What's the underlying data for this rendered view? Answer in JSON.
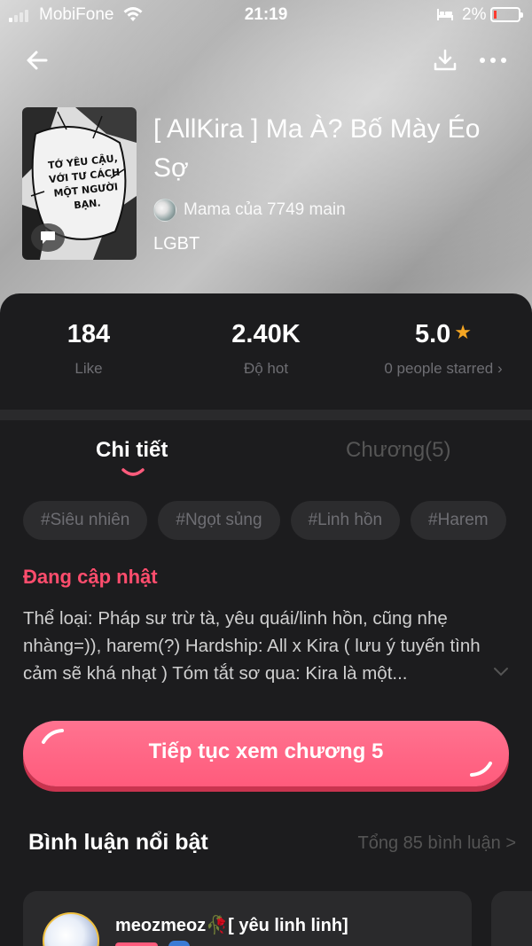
{
  "status_bar": {
    "carrier": "MobiFone",
    "time": "21:19",
    "battery": "2%"
  },
  "book": {
    "title": "[ AllKira ] Ma À? Bố Mày Éo Sợ",
    "author": "Mama của 7749 main",
    "genre": "LGBT",
    "cover_text": "TỚ YÊU CẬU, VỚI TƯ CÁCH MỘT NGƯỜI BẠN."
  },
  "stats": [
    {
      "value": "184",
      "label": "Like"
    },
    {
      "value": "2.40K",
      "label": "Độ hot"
    },
    {
      "value": "5.0",
      "label": "0 people starred ›"
    }
  ],
  "tabs": {
    "details": "Chi tiết",
    "chapters": "Chương(5)"
  },
  "tags": [
    "#Siêu nhiên",
    "#Ngọt sủng",
    "#Linh hồn",
    "#Harem"
  ],
  "status_label": "Đang cập nhật",
  "description": "Thể loại: Pháp sư trừ tà, yêu quái/linh hồn, cũng nhẹ nhàng=)), harem(?)  Hardship: All x Kira ( lưu ý tuyến tình cảm sẽ khá nhạt )  Tóm tắt sơ qua: Kira là một...",
  "continue_button": "Tiếp tục xem chương 5",
  "comments": {
    "title": "Bình luận nổi bật",
    "count": "Tổng 85 bình luận >",
    "items": [
      {
        "user": "meozmeoz🥀[ yêu linh linh]"
      }
    ]
  },
  "colors": {
    "accent": "#ff5b7c",
    "star": "#f5a623",
    "panel": "#1c1c1e"
  }
}
